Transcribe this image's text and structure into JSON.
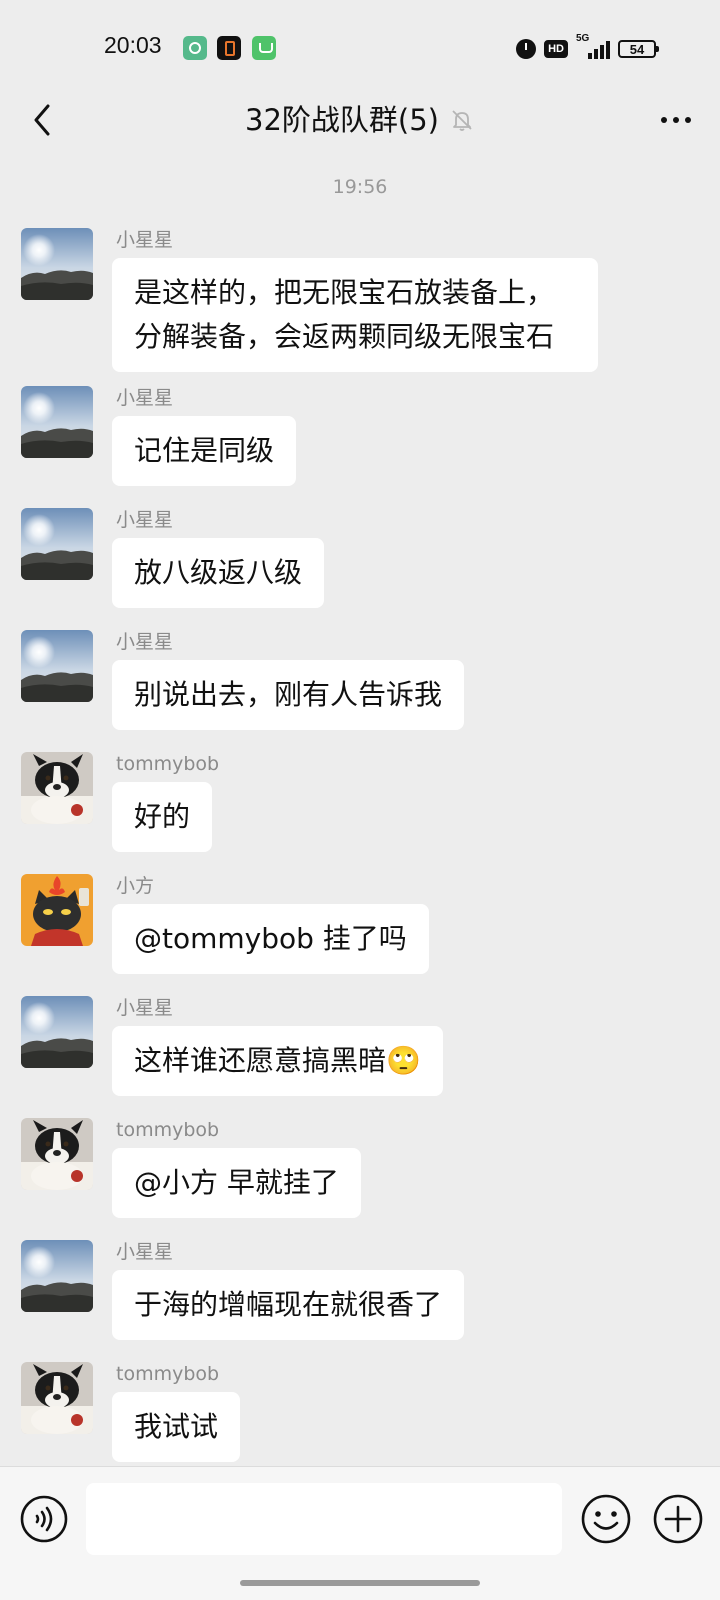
{
  "status_bar": {
    "time": "20:03",
    "network_type": "5G",
    "hd_badge": "HD",
    "battery_level": "54",
    "app_icons": [
      "green-circle-app-icon",
      "black-orange-app-icon",
      "green-sim-app-icon"
    ],
    "system_icons": [
      "alarm-icon",
      "hd-icon",
      "signal-icon",
      "battery-icon"
    ]
  },
  "header": {
    "title": "32阶战队群(5)",
    "back_icon": "chevron-left-icon",
    "mute_icon": "bell-muted-icon",
    "more_icon": "more-horizontal-icon"
  },
  "chat": {
    "timestamp": "19:56",
    "messages": [
      {
        "sender": "小星星",
        "avatar": "landscape-avatar",
        "text": "是这样的，把无限宝石放装备上，分解装备，会返两颗同级无限宝石"
      },
      {
        "sender": "小星星",
        "avatar": "landscape-avatar",
        "text": "记住是同级"
      },
      {
        "sender": "小星星",
        "avatar": "landscape-avatar",
        "text": "放八级返八级"
      },
      {
        "sender": "小星星",
        "avatar": "landscape-avatar",
        "text": "别说出去，刚有人告诉我"
      },
      {
        "sender": "tommybob",
        "avatar": "bulldog-avatar",
        "text": "好的"
      },
      {
        "sender": "小方",
        "avatar": "black-cat-avatar",
        "text": "@tommybob  挂了吗"
      },
      {
        "sender": "小星星",
        "avatar": "landscape-avatar",
        "text": "这样谁还愿意搞黑暗🙄"
      },
      {
        "sender": "tommybob",
        "avatar": "bulldog-avatar",
        "text": "@小方  早就挂了"
      },
      {
        "sender": "小星星",
        "avatar": "landscape-avatar",
        "text": "于海的增幅现在就很香了"
      },
      {
        "sender": "tommybob",
        "avatar": "bulldog-avatar",
        "text": "我试试"
      }
    ]
  },
  "input_bar": {
    "text_value": "",
    "voice_icon": "voice-icon",
    "emoji_icon": "emoji-icon",
    "plus_icon": "plus-circle-icon"
  },
  "colors": {
    "chat_background": "#ededed",
    "bubble_background": "#ffffff",
    "sender_name": "#8a8a8a",
    "input_bar_background": "#f6f6f6"
  }
}
